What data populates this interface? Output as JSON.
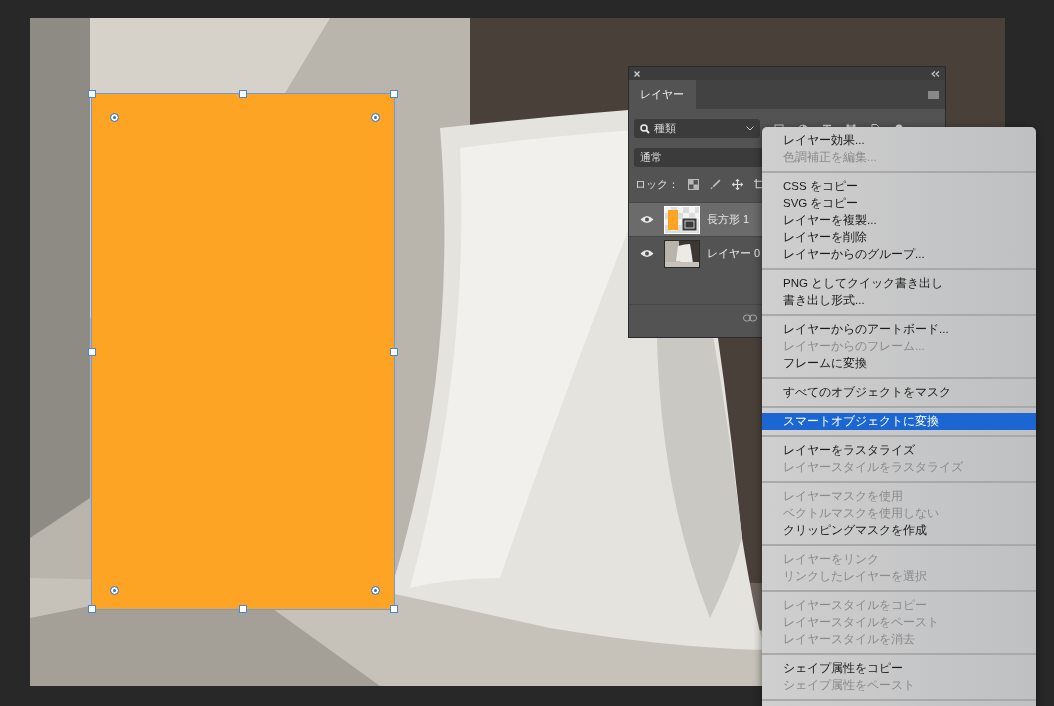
{
  "layers_panel": {
    "tab": {
      "label": "レイヤー",
      "selected": true
    },
    "filter": {
      "value": "種類"
    },
    "blend_mode": {
      "value": "通常"
    },
    "lock_label": "ロック：",
    "layers": [
      {
        "name": "長方形 1",
        "kind": "shape",
        "selected": true,
        "visible": true
      },
      {
        "name": "レイヤー 0",
        "kind": "pixel",
        "selected": false,
        "visible": true
      }
    ]
  },
  "context_menu": {
    "groups": [
      [
        {
          "label": "レイヤー効果...",
          "disabled": false,
          "selected": false
        },
        {
          "label": "色調補正を編集...",
          "disabled": true,
          "selected": false
        }
      ],
      [
        {
          "label": "CSS をコピー",
          "disabled": false,
          "selected": false
        },
        {
          "label": "SVG をコピー",
          "disabled": false,
          "selected": false
        },
        {
          "label": "レイヤーを複製...",
          "disabled": false,
          "selected": false
        },
        {
          "label": "レイヤーを削除",
          "disabled": false,
          "selected": false
        },
        {
          "label": "レイヤーからのグループ...",
          "disabled": false,
          "selected": false
        }
      ],
      [
        {
          "label": "PNG としてクイック書き出し",
          "disabled": false,
          "selected": false
        },
        {
          "label": "書き出し形式...",
          "disabled": false,
          "selected": false
        }
      ],
      [
        {
          "label": "レイヤーからのアートボード...",
          "disabled": false,
          "selected": false
        },
        {
          "label": "レイヤーからのフレーム...",
          "disabled": true,
          "selected": false
        },
        {
          "label": "フレームに変換",
          "disabled": false,
          "selected": false
        }
      ],
      [
        {
          "label": "すべてのオブジェクトをマスク",
          "disabled": false,
          "selected": false
        }
      ],
      [
        {
          "label": "スマートオブジェクトに変換",
          "disabled": false,
          "selected": true
        }
      ],
      [
        {
          "label": "レイヤーをラスタライズ",
          "disabled": false,
          "selected": false
        },
        {
          "label": "レイヤースタイルをラスタライズ",
          "disabled": true,
          "selected": false
        }
      ],
      [
        {
          "label": "レイヤーマスクを使用",
          "disabled": true,
          "selected": false
        },
        {
          "label": "ベクトルマスクを使用しない",
          "disabled": true,
          "selected": false
        },
        {
          "label": "クリッピングマスクを作成",
          "disabled": false,
          "selected": false
        }
      ],
      [
        {
          "label": "レイヤーをリンク",
          "disabled": true,
          "selected": false
        },
        {
          "label": "リンクしたレイヤーを選択",
          "disabled": true,
          "selected": false
        }
      ],
      [
        {
          "label": "レイヤースタイルをコピー",
          "disabled": true,
          "selected": false
        },
        {
          "label": "レイヤースタイルをペースト",
          "disabled": true,
          "selected": false
        },
        {
          "label": "レイヤースタイルを消去",
          "disabled": true,
          "selected": false
        }
      ],
      [
        {
          "label": "シェイプ属性をコピー",
          "disabled": false,
          "selected": false
        },
        {
          "label": "シェイプ属性をペースト",
          "disabled": true,
          "selected": false
        }
      ]
    ]
  }
}
